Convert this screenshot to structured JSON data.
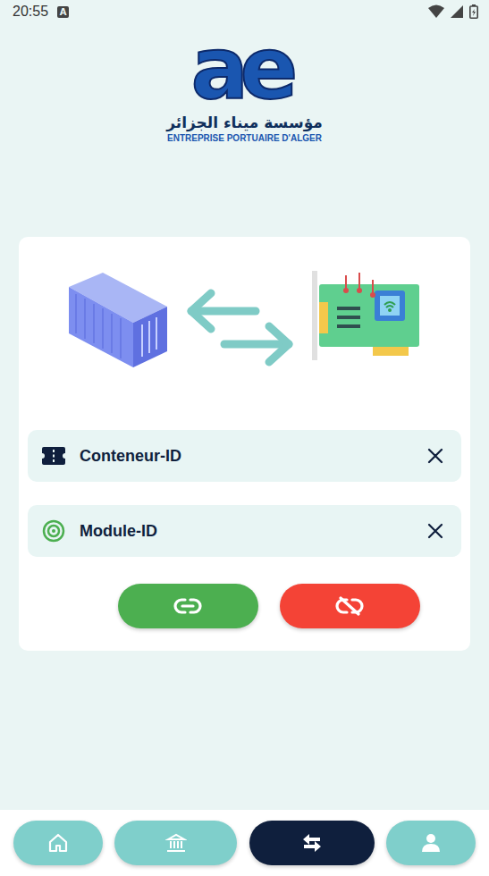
{
  "status_bar": {
    "time": "20:55",
    "notification": "A"
  },
  "header": {
    "logo_mark": "ae",
    "name_ar": "مؤسسة ميناء الجزائر",
    "name_fr": "ENTREPRISE PORTUAIRE D'ALGER"
  },
  "fields": [
    {
      "kind": "container",
      "label": "Conteneur-ID"
    },
    {
      "kind": "module",
      "label": "Module-ID"
    }
  ],
  "buttons": [
    {
      "kind": "link",
      "color": "#4caf50"
    },
    {
      "kind": "unlink",
      "color": "#f44336"
    }
  ],
  "nav": [
    {
      "kind": "home",
      "selected": false
    },
    {
      "kind": "bank",
      "selected": false
    },
    {
      "kind": "swap",
      "selected": true
    },
    {
      "kind": "profile",
      "selected": false
    }
  ]
}
